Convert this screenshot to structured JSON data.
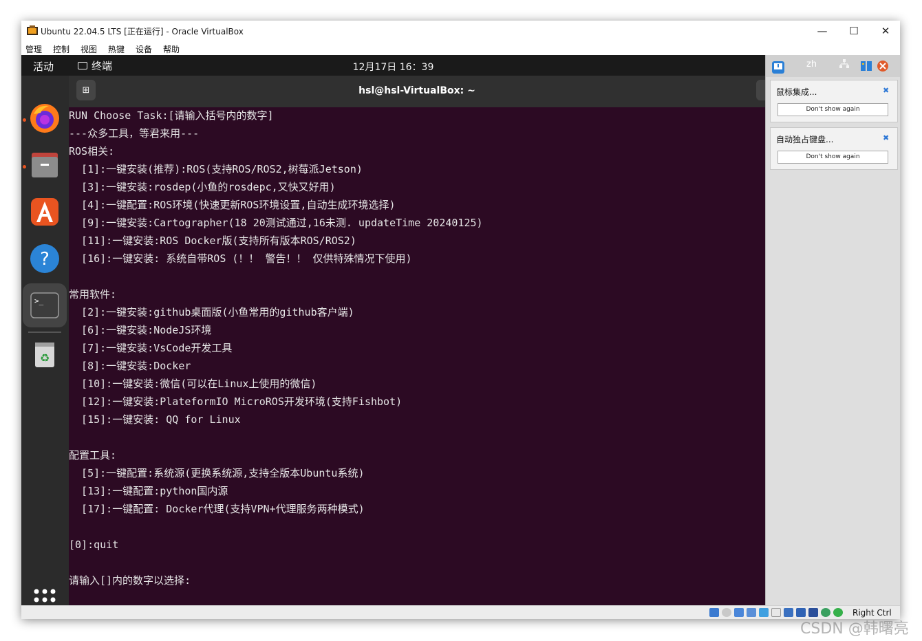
{
  "window": {
    "title": "Ubuntu 22.04.5 LTS [正在运行] - Oracle VirtualBox",
    "minimize": "—",
    "maximize": "☐",
    "close": "✕"
  },
  "menu": [
    "管理",
    "控制",
    "视图",
    "热键",
    "设备",
    "帮助"
  ],
  "gnome": {
    "activities": "活动",
    "app_name": "终端",
    "clock": "12月17日  16：39"
  },
  "dock": {
    "icons": [
      "firefox-icon",
      "files-icon",
      "app-center-icon",
      "help-icon",
      "terminal-icon",
      "trash-icon",
      "show-apps-icon"
    ]
  },
  "terminal": {
    "title": "hsl@hsl-VirtualBox: ~",
    "new_tab": "⊞",
    "lines": [
      "RUN Choose Task:[请输入括号内的数字]",
      "---众多工具，等君来用---",
      "ROS相关:",
      "  [1]:一键安装(推荐):ROS(支持ROS/ROS2,树莓派Jetson)",
      "  [3]:一键安装:rosdep(小鱼的rosdepc,又快又好用)",
      "  [4]:一键配置:ROS环境(快速更新ROS环境设置,自动生成环境选择)",
      "  [9]:一键安装:Cartographer(18 20测试通过,16未测. updateTime 20240125)",
      "  [11]:一键安装:ROS Docker版(支持所有版本ROS/ROS2)",
      "  [16]:一键安装: 系统自带ROS (！！ 警告！！ 仅供特殊情况下使用)",
      "",
      "常用软件:",
      "  [2]:一键安装:github桌面版(小鱼常用的github客户端)",
      "  [6]:一键安装:NodeJS环境",
      "  [7]:一键安装:VsCode开发工具",
      "  [8]:一键安装:Docker",
      "  [10]:一键安装:微信(可以在Linux上使用的微信)",
      "  [12]:一键安装:PlateformIO MicroROS开发环境(支持Fishbot)",
      "  [15]:一键安装: QQ for Linux",
      "",
      "配置工具:",
      "  [5]:一键配置:系统源(更换系统源,支持全版本Ubuntu系统)",
      "  [13]:一键配置:python国内源",
      "  [17]:一键配置: Docker代理(支持VPN+代理服务两种模式)",
      "",
      "[0]:quit",
      "",
      "请输入[]内的数字以选择:"
    ]
  },
  "notifications": {
    "top_label": "zh",
    "items": [
      {
        "title": "鼠标集成...",
        "button": "Don't show again"
      },
      {
        "title": "自动独占键盘...",
        "button": "Don't show again"
      }
    ]
  },
  "status_bar": {
    "host_key": "Right Ctrl"
  },
  "watermark": "CSDN @韩曙亮",
  "colors": {
    "terminal_bg": "#2c0a23",
    "accent": "#e95420"
  }
}
